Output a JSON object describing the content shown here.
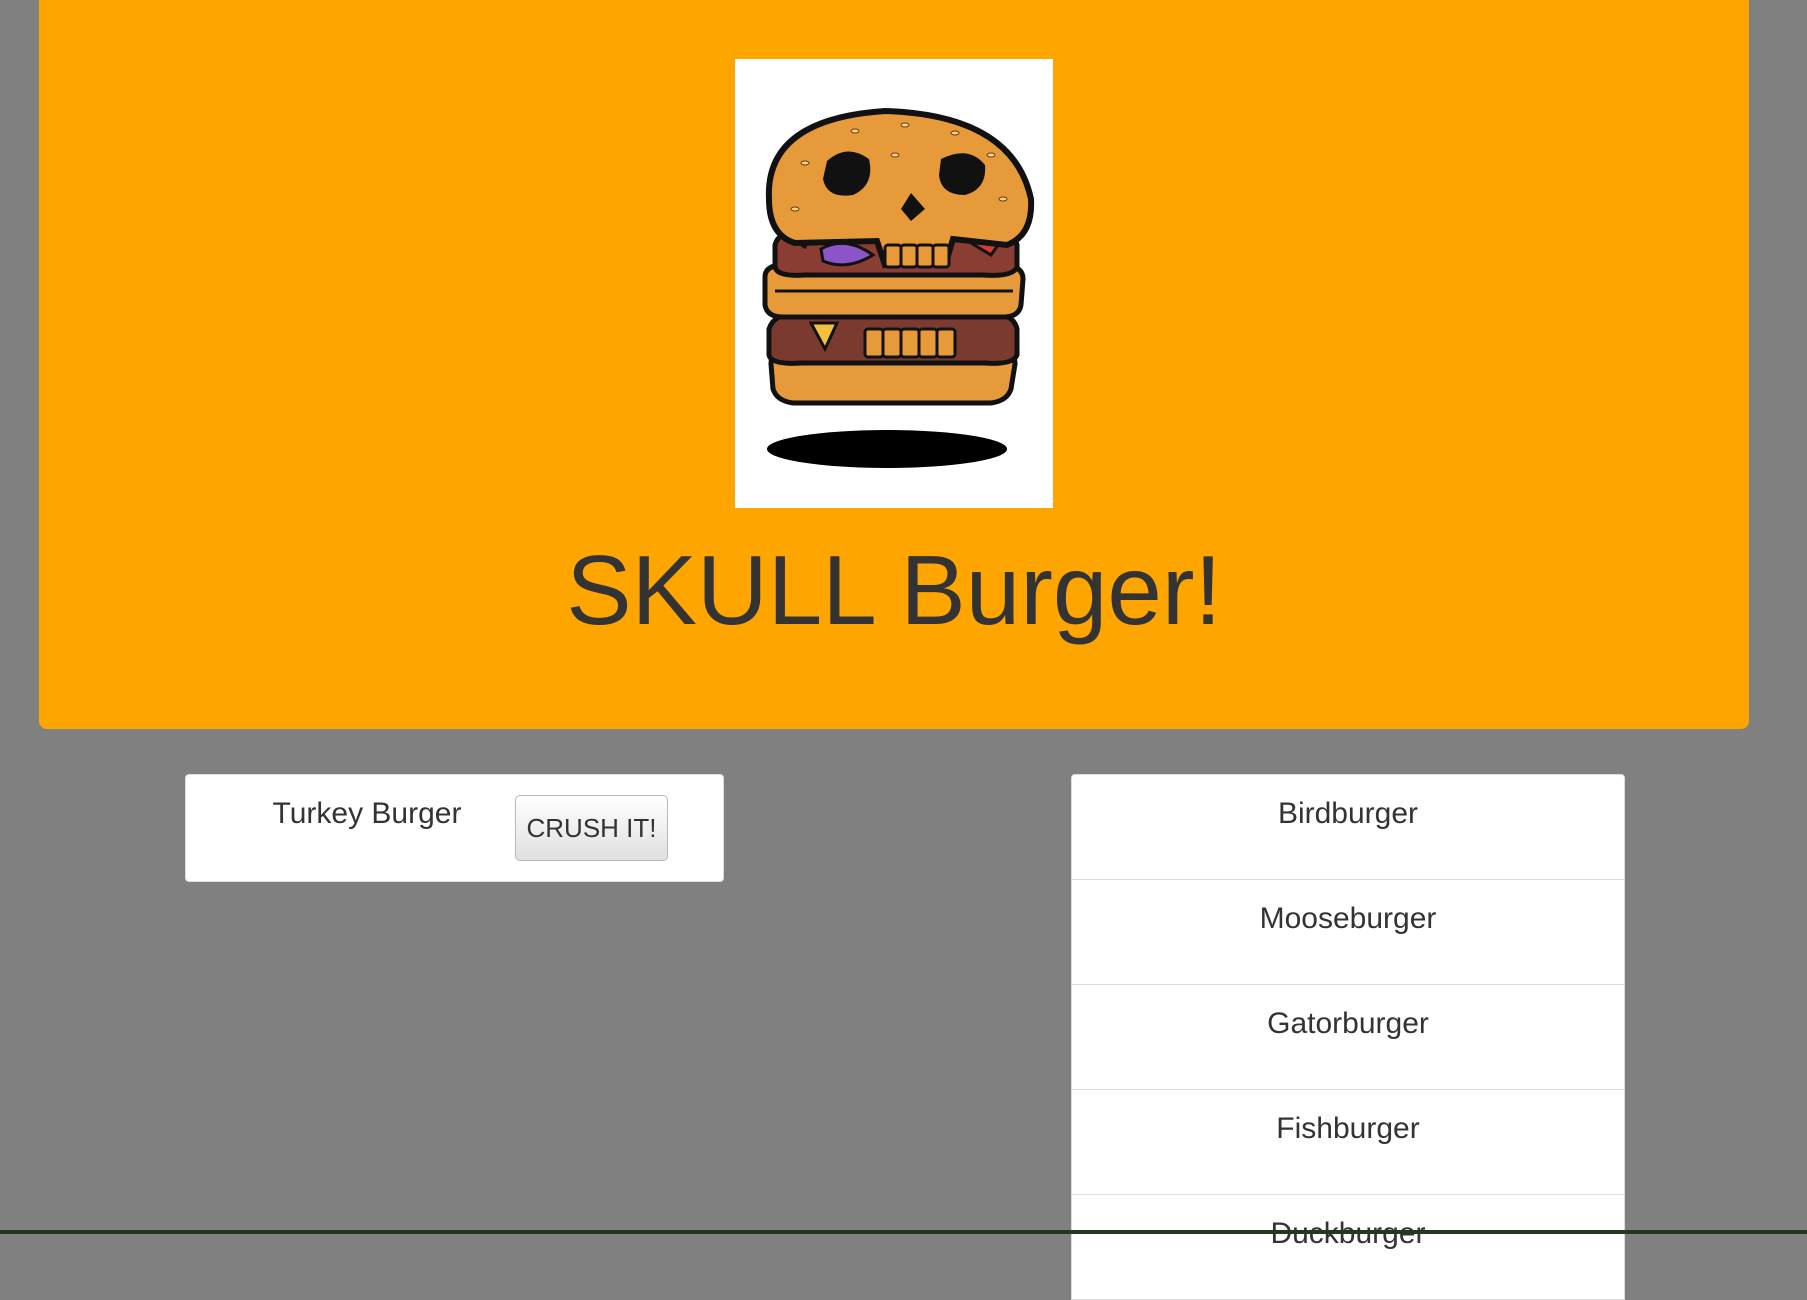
{
  "header": {
    "title": "SKULL Burger!",
    "logo_icon": "skull-burger-icon"
  },
  "uneaten_burgers": [
    {
      "name": "Turkey Burger",
      "button_label": "CRUSH IT!"
    }
  ],
  "eaten_burgers": [
    {
      "name": "Birdburger"
    },
    {
      "name": "Mooseburger"
    },
    {
      "name": "Gatorburger"
    },
    {
      "name": "Fishburger"
    },
    {
      "name": "Duckburger"
    }
  ],
  "colors": {
    "page_background": "#808080",
    "header_background": "#ffa500",
    "card_background": "#ffffff",
    "text": "#333333"
  }
}
